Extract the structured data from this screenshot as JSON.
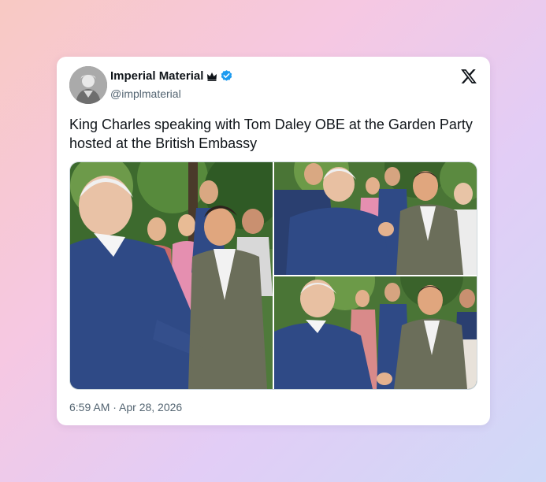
{
  "tweet": {
    "author": {
      "name": "Imperial Material",
      "handle": "@implmaterial",
      "badges": [
        "crown-icon",
        "verified-badge-icon"
      ],
      "avatar": "avatar-image"
    },
    "platform_icon": "x-logo-icon",
    "text": "King Charles speaking with Tom Daley OBE at the Garden Party hosted at the British Embassy",
    "media": [
      {
        "name": "photo-handshake-wide"
      },
      {
        "name": "photo-conversation-top"
      },
      {
        "name": "photo-conversation-bottom"
      }
    ],
    "timestamp": "6:59 AM · Apr 28, 2026"
  },
  "colors": {
    "verified": "#1d9bf0",
    "text": "#0f1419",
    "muted": "#536471",
    "suit_blue": "#2f4a86",
    "jacket_olive": "#6b6e5a",
    "foliage": "#3f6b33"
  }
}
